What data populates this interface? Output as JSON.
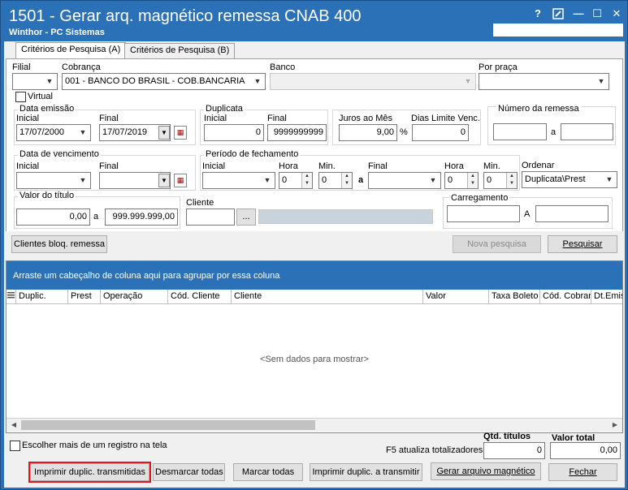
{
  "window": {
    "title": "1501 - Gerar arq. magnético remessa CNAB 400",
    "subtitle": "Winthor - PC Sistemas",
    "buttons": {
      "help": "?",
      "restore_icon": "edit-icon",
      "minimize": "—",
      "maximize": "☐",
      "close": "✕"
    }
  },
  "tabs": [
    {
      "label": "Critérios de Pesquisa (A)",
      "active": true
    },
    {
      "label": "Critérios de Pesquisa (B)",
      "active": false
    }
  ],
  "filters": {
    "filial": {
      "label": "Filial",
      "value": ""
    },
    "cobranca": {
      "label": "Cobrança",
      "value": "001 - BANCO DO BRASIL - COB.BANCARIA"
    },
    "banco": {
      "label": "Banco",
      "value": ""
    },
    "por_praca": {
      "label": "Por praça",
      "value": ""
    },
    "virtual": {
      "label": "Virtual",
      "checked": false
    },
    "data_emissao": {
      "label": "Data emissão",
      "inicial_label": "Inicial",
      "inicial": "17/07/2000",
      "final_label": "Final",
      "final": "17/07/2019"
    },
    "duplicata": {
      "label": "Duplicata",
      "inicial_label": "Inicial",
      "inicial": "0",
      "final_label": "Final",
      "final": "9999999999"
    },
    "juros": {
      "label": "Juros ao Mês",
      "value": "9,00",
      "unit": "%"
    },
    "dias_limite": {
      "label": "Dias Limite Venc.",
      "value": "0"
    },
    "numero_remessa": {
      "label": "Número da remessa",
      "from": "",
      "sep": "a",
      "to": ""
    },
    "data_vencimento": {
      "label": "Data de vencimento",
      "inicial_label": "Inicial",
      "inicial": "",
      "final_label": "Final",
      "final": ""
    },
    "periodo_fechamento": {
      "label": "Período de fechamento",
      "inicial_label": "Inicial",
      "inicial": "",
      "hora_label": "Hora",
      "hora1": "0",
      "min_label": "Min.",
      "min1": "0",
      "sep": "a",
      "final_label": "Final",
      "final": "",
      "hora2": "0",
      "min2": "0"
    },
    "ordenar": {
      "label": "Ordenar",
      "value": "Duplicata\\Prest"
    },
    "valor_titulo": {
      "label": "Valor do título",
      "from": "0,00",
      "sep": "a",
      "to": "999.999.999,00"
    },
    "cliente": {
      "label": "Cliente",
      "code": "",
      "ellipsis": "...",
      "name": ""
    },
    "carregamento": {
      "label": "Carregamento",
      "from": "",
      "sep": "A",
      "to": ""
    }
  },
  "actions": {
    "clientes_bloq": "Clientes bloq. remessa",
    "nova_pesquisa": "Nova pesquisa",
    "pesquisar": "Pesquisar"
  },
  "grid": {
    "group_hint": "Arraste um cabeçalho de coluna aqui para agrupar por essa coluna",
    "columns": [
      "Duplic.",
      "Prest",
      "Operação",
      "Cód. Cliente",
      "Cliente",
      "Valor",
      "Taxa Boleto",
      "Cód. Cobran",
      "Dt.Emis"
    ],
    "empty_text": "<Sem dados para mostrar>"
  },
  "footer": {
    "multi_select_label": "Escolher mais de um registro na tela",
    "f5_hint": "F5 atualiza totalizadores",
    "qtd_titulos_label": "Qtd. títulos",
    "qtd_titulos": "0",
    "valor_total_label": "Valor total",
    "valor_total": "0,00",
    "buttons": {
      "imprimir_transmitidas": "Imprimir duplic. transmitidas",
      "desmarcar_todas": "Desmarcar todas",
      "marcar_todas": "Marcar todas",
      "imprimir_a_transmitir": "Imprimir duplic. a transmitir",
      "gerar_arquivo": "Gerar arquivo magnético",
      "fechar": "Fechar"
    }
  }
}
